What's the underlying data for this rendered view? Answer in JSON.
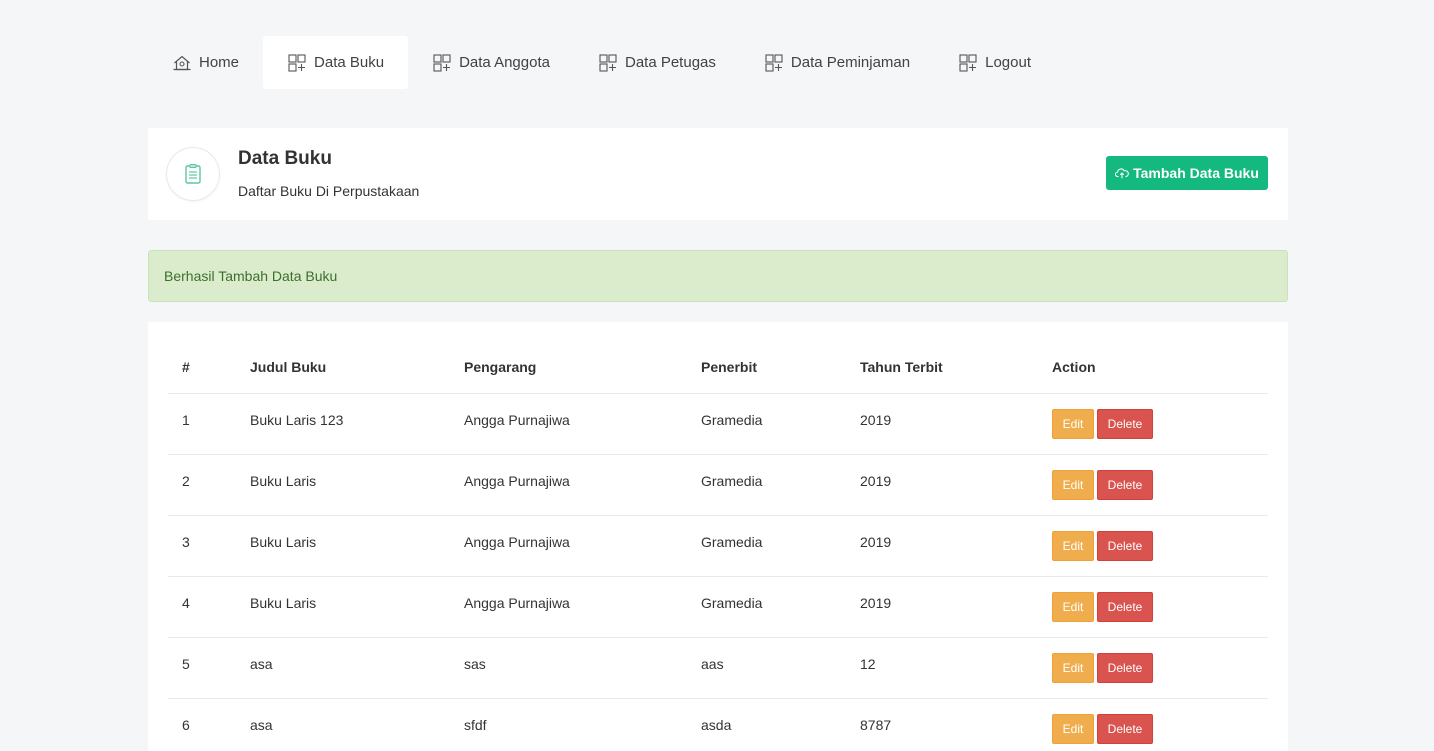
{
  "nav": {
    "items": [
      {
        "label": "Home",
        "icon": "home-icon",
        "active": false
      },
      {
        "label": "Data Buku",
        "icon": "grid-plus-icon",
        "active": true
      },
      {
        "label": "Data Anggota",
        "icon": "grid-plus-icon",
        "active": false
      },
      {
        "label": "Data Petugas",
        "icon": "grid-plus-icon",
        "active": false
      },
      {
        "label": "Data Peminjaman",
        "icon": "grid-plus-icon",
        "active": false
      },
      {
        "label": "Logout",
        "icon": "grid-plus-icon",
        "active": false
      }
    ]
  },
  "header": {
    "title": "Data Buku",
    "subtitle": "Daftar Buku Di Perpustakaan",
    "icon": "clipboard-icon",
    "add_button_label": "Tambah Data Buku",
    "add_button_icon": "cloud-upload-icon"
  },
  "alert": {
    "message": "Berhasil Tambah Data Buku"
  },
  "table": {
    "columns": [
      "#",
      "Judul Buku",
      "Pengarang",
      "Penerbit",
      "Tahun Terbit",
      "Action"
    ],
    "rows": [
      {
        "no": "1",
        "judul": "Buku Laris 123",
        "pengarang": "Angga Purnajiwa",
        "penerbit": "Gramedia",
        "tahun": "2019"
      },
      {
        "no": "2",
        "judul": "Buku Laris",
        "pengarang": "Angga Purnajiwa",
        "penerbit": "Gramedia",
        "tahun": "2019"
      },
      {
        "no": "3",
        "judul": "Buku Laris",
        "pengarang": "Angga Purnajiwa",
        "penerbit": "Gramedia",
        "tahun": "2019"
      },
      {
        "no": "4",
        "judul": "Buku Laris",
        "pengarang": "Angga Purnajiwa",
        "penerbit": "Gramedia",
        "tahun": "2019"
      },
      {
        "no": "5",
        "judul": "asa",
        "pengarang": "sas",
        "penerbit": "aas",
        "tahun": "12"
      },
      {
        "no": "6",
        "judul": "asa",
        "pengarang": "sfdf",
        "penerbit": "asda",
        "tahun": "8787"
      }
    ],
    "edit_label": "Edit",
    "delete_label": "Delete"
  },
  "colors": {
    "accent": "#13b97f",
    "edit": "#f0ad4e",
    "delete": "#d9534f",
    "alert_bg": "#dbeccd"
  }
}
